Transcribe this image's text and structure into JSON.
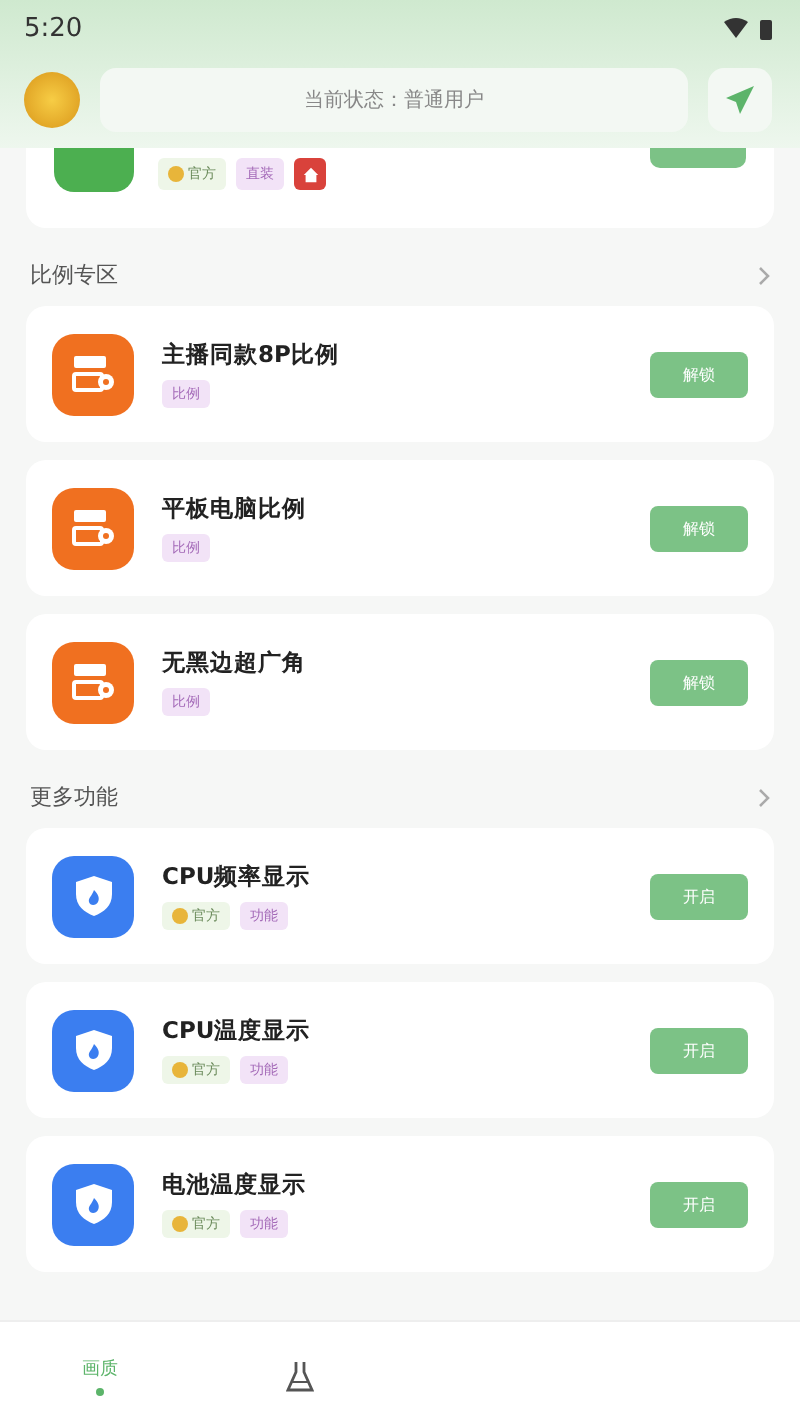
{
  "status_bar": {
    "time": "5:20"
  },
  "header": {
    "status": "当前状态：普通用户"
  },
  "top_card": {
    "tags": [
      {
        "kind": "official",
        "label": "官方"
      },
      {
        "kind": "plain",
        "label": "直装"
      },
      {
        "kind": "home"
      }
    ]
  },
  "sections": [
    {
      "title": "比例专区",
      "items": [
        {
          "title": "主播同款8P比例",
          "tags": [
            {
              "kind": "plain",
              "label": "比例"
            }
          ],
          "button": "解锁"
        },
        {
          "title": "平板电脑比例",
          "tags": [
            {
              "kind": "plain",
              "label": "比例"
            }
          ],
          "button": "解锁"
        },
        {
          "title": "无黑边超广角",
          "tags": [
            {
              "kind": "plain",
              "label": "比例"
            }
          ],
          "button": "解锁"
        }
      ]
    },
    {
      "title": "更多功能",
      "items": [
        {
          "title": "CPU频率显示",
          "tags": [
            {
              "kind": "official",
              "label": "官方"
            },
            {
              "kind": "plain",
              "label": "功能"
            }
          ],
          "button": "开启"
        },
        {
          "title": "CPU温度显示",
          "tags": [
            {
              "kind": "official",
              "label": "官方"
            },
            {
              "kind": "plain",
              "label": "功能"
            }
          ],
          "button": "开启"
        },
        {
          "title": "电池温度显示",
          "tags": [
            {
              "kind": "official",
              "label": "官方"
            },
            {
              "kind": "plain",
              "label": "功能"
            }
          ],
          "button": "开启"
        }
      ]
    }
  ],
  "nav": [
    {
      "kind": "text",
      "label": "画质",
      "selected": true
    },
    {
      "kind": "flask",
      "selected": false
    }
  ]
}
